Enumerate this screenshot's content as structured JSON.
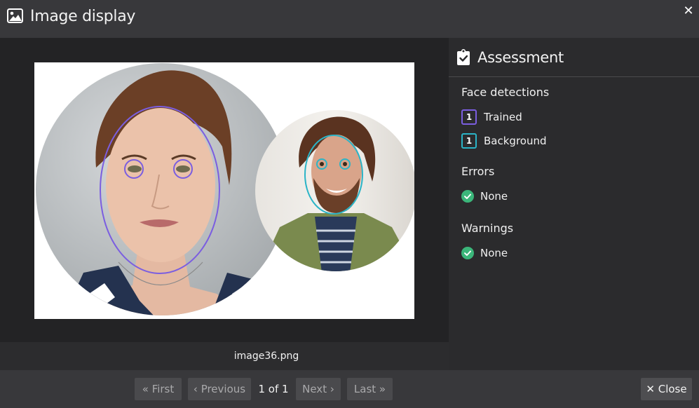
{
  "window": {
    "title": "Image display",
    "title_icon": "image-icon",
    "close_icon": "close-icon"
  },
  "image": {
    "filename": "image36.png"
  },
  "assessment": {
    "title": "Assessment",
    "icon": "clipboard-check-icon",
    "face_detections": {
      "heading": "Face detections",
      "items": [
        {
          "count": "1",
          "label": "Trained",
          "color": "#7b5ee0"
        },
        {
          "count": "1",
          "label": "Background",
          "color": "#2bb4c7"
        }
      ]
    },
    "errors": {
      "heading": "Errors",
      "status": "None",
      "status_color": "#3bb67a"
    },
    "warnings": {
      "heading": "Warnings",
      "status": "None",
      "status_color": "#3bb67a"
    }
  },
  "pagination": {
    "first": "First",
    "previous": "Previous",
    "page_info": "1 of 1",
    "next": "Next",
    "last": "Last"
  },
  "footer": {
    "close": "Close"
  }
}
